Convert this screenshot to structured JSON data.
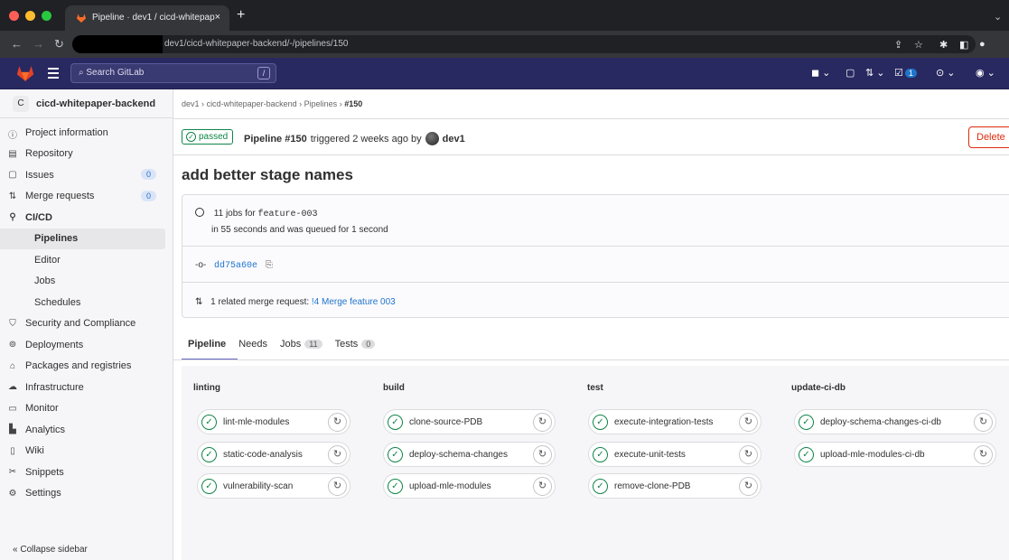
{
  "browser": {
    "tab_title": "Pipeline · dev1 / cicd-whitepap",
    "tab_close": "×",
    "new_tab": "+",
    "url": "dev1/cicd-whitepaper-backend/-/pipelines/150"
  },
  "topbar": {
    "search_placeholder": "Search GitLab",
    "search_shortcut": "/",
    "todo_count": "1"
  },
  "sidebar": {
    "project_initial": "C",
    "project_name": "cicd-whitepaper-backend",
    "items": [
      {
        "label": "Project information",
        "icon": "info-icon"
      },
      {
        "label": "Repository",
        "icon": "file-icon"
      },
      {
        "label": "Issues",
        "icon": "issues-icon",
        "count": "0"
      },
      {
        "label": "Merge requests",
        "icon": "merge-request-icon",
        "count": "0"
      },
      {
        "label": "CI/CD",
        "icon": "rocket-icon"
      },
      {
        "label": "Pipelines"
      },
      {
        "label": "Editor"
      },
      {
        "label": "Jobs"
      },
      {
        "label": "Schedules"
      },
      {
        "label": "Security and Compliance",
        "icon": "shield-icon"
      },
      {
        "label": "Deployments",
        "icon": "deployments-icon"
      },
      {
        "label": "Packages and registries",
        "icon": "package-icon"
      },
      {
        "label": "Infrastructure",
        "icon": "cloud-icon"
      },
      {
        "label": "Monitor",
        "icon": "monitor-icon"
      },
      {
        "label": "Analytics",
        "icon": "chart-icon"
      },
      {
        "label": "Wiki",
        "icon": "book-icon"
      },
      {
        "label": "Snippets",
        "icon": "scissors-icon"
      },
      {
        "label": "Settings",
        "icon": "gear-icon"
      }
    ],
    "collapse_label": "Collapse sidebar"
  },
  "breadcrumb": {
    "items": [
      "dev1",
      "cicd-whitepaper-backend",
      "Pipelines"
    ],
    "current": "#150",
    "sep": "›"
  },
  "pipeline": {
    "status": "passed",
    "name": "Pipeline #150",
    "triggered": "triggered 2 weeks ago by",
    "user": "dev1",
    "delete_label": "Delete",
    "title": "add better stage names",
    "jobs_for": "11 jobs for",
    "branch": "feature-003",
    "duration": "in 55 seconds and was queued for 1 second",
    "commit": "dd75a60e",
    "mr_text": "1 related merge request:",
    "mr_link": "!4 Merge feature 003"
  },
  "tabs": [
    {
      "label": "Pipeline"
    },
    {
      "label": "Needs"
    },
    {
      "label": "Jobs",
      "count": "11"
    },
    {
      "label": "Tests",
      "count": "0"
    }
  ],
  "stages": [
    {
      "name": "linting",
      "jobs": [
        "lint-mle-modules",
        "static-code-analysis",
        "vulnerability-scan"
      ]
    },
    {
      "name": "build",
      "jobs": [
        "clone-source-PDB",
        "deploy-schema-changes",
        "upload-mle-modules"
      ]
    },
    {
      "name": "test",
      "jobs": [
        "execute-integration-tests",
        "execute-unit-tests",
        "remove-clone-PDB"
      ]
    },
    {
      "name": "update-ci-db",
      "jobs": [
        "deploy-schema-changes-ci-db",
        "upload-mle-modules-ci-db"
      ]
    }
  ],
  "colors": {
    "success": "#108548",
    "nav": "#292961",
    "link": "#1f75cb",
    "danger": "#dd2b0e"
  }
}
